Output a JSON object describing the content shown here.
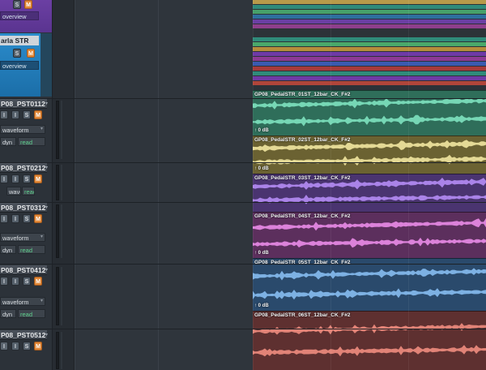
{
  "folders": {
    "top_buttons": {
      "s": "S",
      "m": "M"
    },
    "folder2": {
      "name": "arla STR",
      "s": "S",
      "m": "M",
      "mode": "overview"
    },
    "top_mode": "overview"
  },
  "tracks": [
    {
      "name": "P08_PST0112",
      "btn1": "I",
      "btn2": "S",
      "btn3": "M",
      "view": "waveform",
      "auto_label": "dyn",
      "auto_mode": "read"
    },
    {
      "name": "P08_PST0212",
      "btn1": "I",
      "btn2": "S",
      "btn3": "M",
      "view": "wave",
      "auto_label": "",
      "auto_mode": "read"
    },
    {
      "name": "P08_PST0312",
      "btn1": "I",
      "btn2": "S",
      "btn3": "M",
      "view": "waveform",
      "auto_label": "dyn",
      "auto_mode": "read"
    },
    {
      "name": "P08_PST0412",
      "btn1": "I",
      "btn2": "S",
      "btn3": "M",
      "view": "waveform",
      "auto_label": "dyn",
      "auto_mode": "read"
    },
    {
      "name": "P08_PST0512",
      "btn1": "I",
      "btn2": "S",
      "btn3": "M",
      "view": "",
      "auto_label": "",
      "auto_mode": ""
    }
  ],
  "clips": [
    {
      "title": "GP08_PedalSTR_01ST_12bar_CK_F#2",
      "gain": "0 dB",
      "color": "#2f6e5a",
      "wave": "#7ee2bf"
    },
    {
      "title": "GP08_PedalSTR_02ST_12bar_CK_F#2",
      "gain": "0 dB",
      "color": "#6b6232",
      "wave": "#f2e7a0"
    },
    {
      "title": "GP08_PedalSTR_03ST_12bar_CK_F#2",
      "gain": "",
      "color": "#4a3470",
      "wave": "#b58cf5"
    },
    {
      "title": "GP08_PedalSTR_04ST_12bar_CK_F#2",
      "gain": "0 dB",
      "color": "#5c2f5d",
      "wave": "#ea8ce8"
    },
    {
      "title": "GP08_PedalSTR_05ST_12bar_CK_F#2",
      "gain": "0 dB",
      "color": "#2a4a6c",
      "wave": "#86bdf1"
    },
    {
      "title": "GP08_PedalSTR_06ST_12bar_CK_F#2",
      "gain": "",
      "color": "#5e3030",
      "wave": "#ef8d80"
    }
  ],
  "colors": {
    "mute": "#e38a3a",
    "read": "#5fd28e",
    "top_stripes": [
      "#b79a4a",
      "#2f8b7a",
      "#47a06a",
      "#2d6f9e",
      "#6b3fa3",
      "#8e3f8c"
    ],
    "folder2_stripes": [
      "#2f8b7a",
      "#4aa86a",
      "#b58d3b",
      "#6e3aa6",
      "#8c3a93",
      "#3a5ab0",
      "#a63a3a",
      "#2f8b7a",
      "#6e3aa6",
      "#b0453a"
    ]
  }
}
